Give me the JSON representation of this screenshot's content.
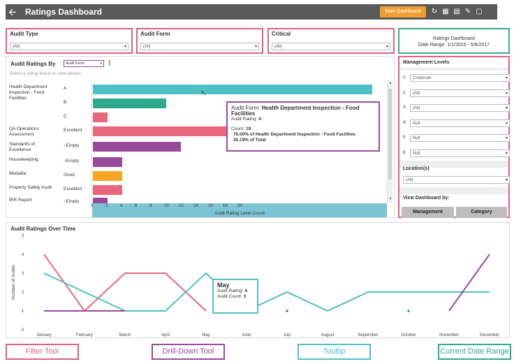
{
  "header": {
    "title": "Ratings Dashboard",
    "main_dashboard_label": "Main Dashboard",
    "icons": [
      "back-arrow-icon",
      "refresh-icon",
      "calendar-icon",
      "document-icon",
      "edit-icon",
      "trash-icon"
    ]
  },
  "filters": [
    {
      "label": "Audit Type",
      "value": "(All)"
    },
    {
      "label": "Audit Form",
      "value": "(All)"
    },
    {
      "label": "Critical",
      "value": "(All)"
    }
  ],
  "date_range": {
    "title": "Ratings Dashboard",
    "label": "Date Range",
    "value": "1/1/2015 - 5/8/2017"
  },
  "ratings_by": {
    "title": "Audit Ratings By",
    "selected": "Audit Form",
    "hint": "Select a rating below to view details",
    "axis_title": "Audit Rating Level Count",
    "ticks": [
      "0",
      "2",
      "4",
      "6",
      "8",
      "10",
      "12",
      "14",
      "16",
      "18",
      "20"
    ],
    "rows": [
      {
        "group": "Health Department Inspection - Food Facilities",
        "rating": "A",
        "value": 19,
        "color": "#4fc0c6"
      },
      {
        "group": "",
        "rating": "B",
        "value": 5,
        "color": "#2daa8c"
      },
      {
        "group": "",
        "rating": "C",
        "value": 1,
        "color": "#e8677d"
      },
      {
        "group": "QA Operations Assessment",
        "rating": "Excellent",
        "value": 10,
        "color": "#e8677d"
      },
      {
        "group": "Standards of Excellence",
        "rating": "~Empty",
        "value": 6,
        "color": "#9a4a9a"
      },
      {
        "group": "Housekeeping",
        "rating": "~Empty",
        "value": 2,
        "color": "#9a4a9a"
      },
      {
        "group": "Medallia",
        "rating": "Good",
        "value": 2,
        "color": "#f5a623"
      },
      {
        "group": "Property Safety Audit",
        "rating": "Excellent",
        "value": 2,
        "color": "#e8677d"
      },
      {
        "group": "IRR Report",
        "rating": "~Empty",
        "value": 1,
        "color": "#9a4a9a"
      }
    ],
    "tooltip": {
      "form_label": "Audit Form:",
      "form_value": "Health Department Inspection  - Food Facilities",
      "rating_label": "Audit Rating:",
      "rating_value": "A",
      "count_label": "Count:",
      "count_value": "19",
      "pct_form": "76.00% of Health Department Inspection  - Food Facilities",
      "pct_total": "35.19% of Total"
    }
  },
  "management": {
    "title": "Management Levels",
    "levels": [
      {
        "num": "1",
        "value": "Corporate"
      },
      {
        "num": "2",
        "value": "(All)"
      },
      {
        "num": "3",
        "value": "(All)"
      },
      {
        "num": "4",
        "value": "Null"
      },
      {
        "num": "5",
        "value": "Null"
      },
      {
        "num": "6",
        "value": "Null"
      }
    ],
    "location_title": "Location(s)",
    "location_value": "(All)",
    "view_by_title": "View Dashboard by:",
    "btn_management": "Management",
    "btn_category": "Category"
  },
  "time_chart": {
    "title": "Audit Ratings Over Time",
    "ylabel": "Number of Audits",
    "tooltip": {
      "month": "May",
      "rating_label": "Audit Rating:",
      "rating_value": "A",
      "count_label": "Audit Count:",
      "count_value": "3"
    }
  },
  "chart_data": {
    "type": "line",
    "x": [
      "January",
      "February",
      "March",
      "April",
      "May",
      "June",
      "July",
      "August",
      "September",
      "October",
      "November",
      "December"
    ],
    "yticks": [
      "0",
      "1",
      "2",
      "3",
      "4",
      "5"
    ],
    "ylim": [
      0,
      5
    ],
    "series": [
      {
        "color": "#e8677d",
        "values": [
          4,
          1,
          3,
          3,
          1,
          null,
          null,
          null,
          null,
          null,
          null,
          null
        ]
      },
      {
        "color": "#4fc0c6",
        "values": [
          3,
          2,
          1,
          1,
          3,
          1,
          2,
          1,
          2,
          2,
          2,
          2
        ]
      },
      {
        "color": "#9a4a9a",
        "values": [
          1,
          1,
          1,
          null,
          null,
          null,
          1,
          null,
          null,
          null,
          1,
          4
        ]
      },
      {
        "color": "#2daa8c",
        "values": [
          null,
          null,
          null,
          null,
          null,
          null,
          null,
          null,
          null,
          1,
          null,
          null
        ]
      }
    ]
  },
  "legend": {
    "filter": "Filter Tool",
    "drilldown": "Drill-Down Tool",
    "tooltip": "Tooltip",
    "date": "Current Date Range",
    "colors": {
      "filter": "#e06080",
      "drilldown": "#9a4a9a",
      "tooltip": "#4fc0c6",
      "date": "#2daa8c"
    }
  }
}
